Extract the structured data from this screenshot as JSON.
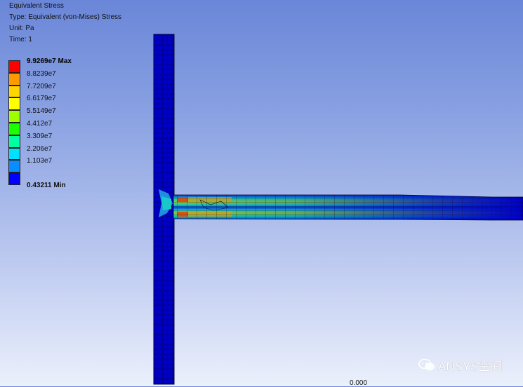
{
  "result_info": {
    "title": "Equivalent Stress",
    "type": "Type: Equivalent (von-Mises) Stress",
    "unit": "Unit: Pa",
    "time": "Time: 1"
  },
  "legend": {
    "max_label": "9.9269e7 Max",
    "min_label": "0.43211 Min",
    "levels": [
      "8.8239e7",
      "7.7209e7",
      "6.6179e7",
      "5.5149e7",
      "4.412e7",
      "3.309e7",
      "2.206e7",
      "1.103e7"
    ],
    "colors": [
      "#ff0000",
      "#ff9a00",
      "#ffd500",
      "#ffff00",
      "#9dff00",
      "#1bff00",
      "#00ffa0",
      "#00e0ff",
      "#0a8eff",
      "#0000ff"
    ]
  },
  "scale_label": "0.000",
  "watermark": "ANSYS空间"
}
